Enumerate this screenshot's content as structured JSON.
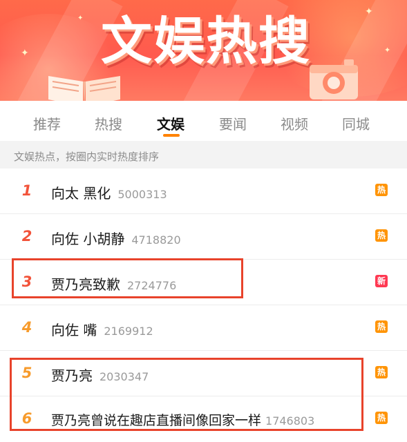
{
  "banner": {
    "title": "文娱热搜"
  },
  "tabs": [
    "推荐",
    "热搜",
    "文娱",
    "要闻",
    "视频",
    "同城"
  ],
  "active_tab": "文娱",
  "subtitle": "文娱热点，按圈内实时热度排序",
  "list": [
    {
      "rank": "1",
      "title": "向太 黑化",
      "count": "5000313",
      "badge": "热"
    },
    {
      "rank": "2",
      "title": "向佐 小胡静",
      "count": "4718820",
      "badge": "热"
    },
    {
      "rank": "3",
      "title": "贾乃亮致歉",
      "count": "2724776",
      "badge": "新"
    },
    {
      "rank": "4",
      "title": "向佐 嘴",
      "count": "2169912",
      "badge": "热"
    },
    {
      "rank": "5",
      "title": "贾乃亮",
      "count": "2030347",
      "badge": "热"
    },
    {
      "rank": "6",
      "title": "贾乃亮曾说在趣店直播间像回家一样",
      "count": "1746803",
      "badge": "热"
    }
  ],
  "colors": {
    "accent": "#ff8200",
    "hot_badge": "#ff9406",
    "new_badge": "#ff3852",
    "highlight_box": "#e8432b"
  }
}
